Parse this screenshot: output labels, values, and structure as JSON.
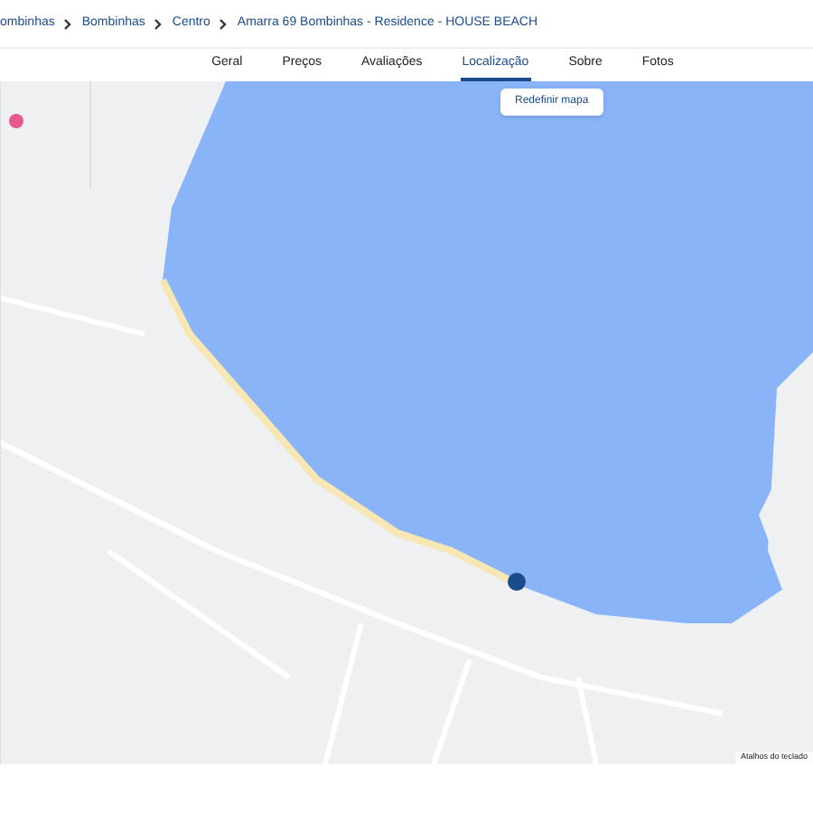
{
  "breadcrumb": [
    "ombinhas",
    "Bombinhas",
    "Centro",
    "Amarra 69 Bombinhas - Residence - HOUSE BEACH"
  ],
  "tabs": [
    {
      "label": "Geral",
      "selected": false
    },
    {
      "label": "Preços",
      "selected": false
    },
    {
      "label": "Avaliações",
      "selected": false
    },
    {
      "label": "Localização",
      "selected": true
    },
    {
      "label": "Sobre",
      "selected": false
    },
    {
      "label": "Fotos",
      "selected": false
    }
  ],
  "map": {
    "reset_button": "Redefinir mapa",
    "attribution": "Atalhos do teclado"
  }
}
